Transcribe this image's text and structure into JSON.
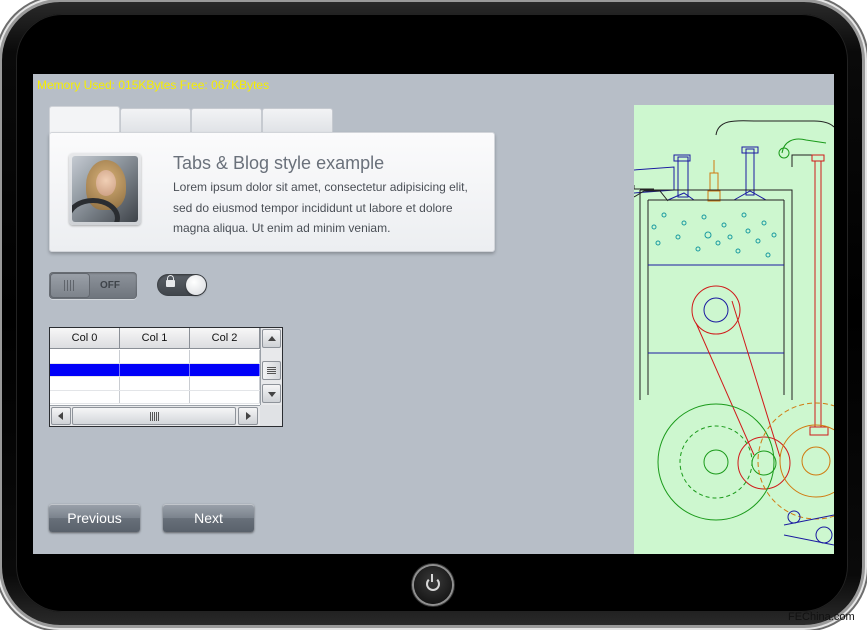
{
  "status": {
    "memory_text": "Memory Used: 015KBytes Free: 067KBytes"
  },
  "tabs": [
    {
      "label": ""
    },
    {
      "label": ""
    },
    {
      "label": ""
    },
    {
      "label": ""
    }
  ],
  "panel": {
    "title": "Tabs & Blog style example",
    "body": "Lorem ipsum dolor sit amet, consectetur adipisicing elit, sed do eiusmod tempor incididunt ut labore et dolore magna aliqua. Ut enim ad minim veniam."
  },
  "toggle": {
    "label": "OFF"
  },
  "grid": {
    "columns": [
      "Col 0",
      "Col 1",
      "Col 2"
    ],
    "rows": [
      [
        "",
        "",
        ""
      ],
      [
        "",
        "",
        ""
      ],
      [
        "",
        "",
        ""
      ],
      [
        "",
        "",
        ""
      ]
    ],
    "selected_row": 1
  },
  "buttons": {
    "previous": "Previous",
    "next": "Next"
  },
  "watermark": "FEChina.com",
  "colors": {
    "memory_text": "#f6ee00",
    "screen_bg": "#b7bec7",
    "selection": "#0000f8",
    "drawing_bg": "#cdf7cf"
  },
  "icons": [
    "lock-icon",
    "power-icon",
    "scroll-up-arrow-icon",
    "scroll-down-arrow-icon",
    "scroll-left-arrow-icon",
    "scroll-right-arrow-icon"
  ]
}
